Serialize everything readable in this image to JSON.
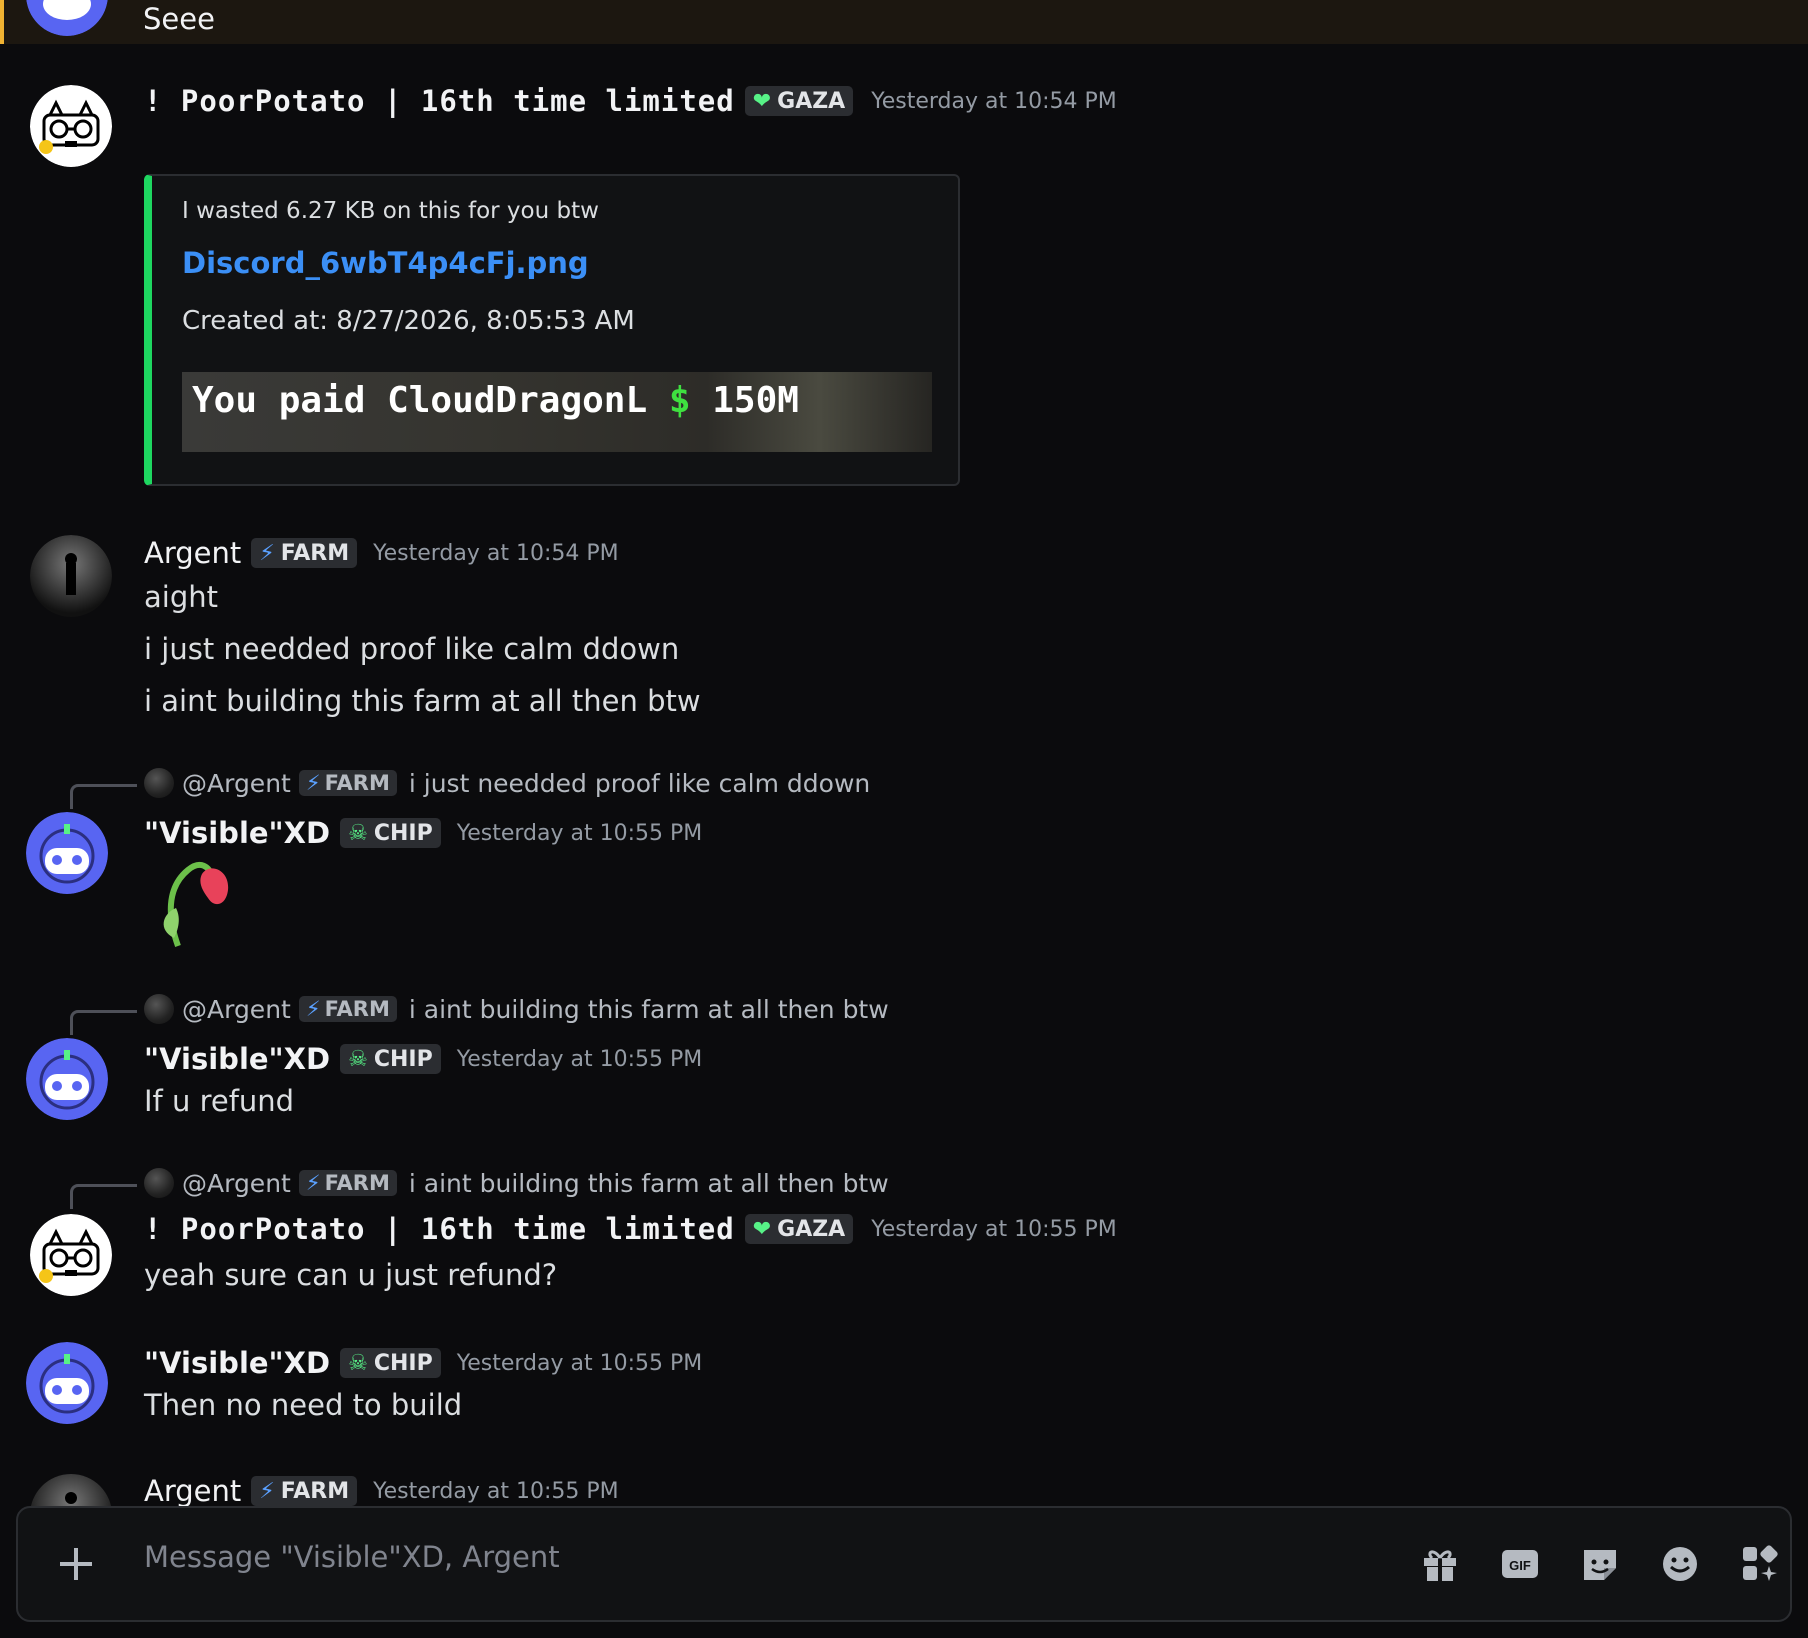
{
  "top_message": {
    "text": "Seee"
  },
  "messages": [
    {
      "author": "! PoorPotato | 16th time limited",
      "tag": "GAZA",
      "timestamp": "Yesterday at 10:54 PM",
      "embed": {
        "line1": "I wasted 6.27 KB on this for you btw",
        "link": "Discord_6wbT4p4cFj.png",
        "created": "Created at: 8/27/2026, 8:05:53 AM",
        "image_caption_prefix": "You paid CloudDragonL",
        "image_caption_symbol": "$",
        "image_caption_amount": "150M"
      }
    },
    {
      "author": "Argent",
      "tag": "FARM",
      "timestamp": "Yesterday at 10:54 PM",
      "lines": [
        "aight",
        "i just needded  proof like  calm ddown",
        "i aint building this farm at all then btw"
      ]
    },
    {
      "reply_to": {
        "name": "@Argent",
        "tag": "FARM",
        "text": "i just needded  proof like  calm ddown"
      },
      "author": "\"Visible\"XD",
      "tag": "CHIP",
      "timestamp": "Yesterday at 10:55 PM",
      "emoji": "wilted-flower"
    },
    {
      "reply_to": {
        "name": "@Argent",
        "tag": "FARM",
        "text": "i aint building this farm at all then btw"
      },
      "author": "\"Visible\"XD",
      "tag": "CHIP",
      "timestamp": "Yesterday at 10:55 PM",
      "lines": [
        "If u refund"
      ]
    },
    {
      "reply_to": {
        "name": "@Argent",
        "tag": "FARM",
        "text": "i aint building this farm at all then btw"
      },
      "author": "! PoorPotato | 16th time limited",
      "tag": "GAZA",
      "timestamp": "Yesterday at 10:55 PM",
      "lines": [
        "yeah sure can u just refund?"
      ]
    },
    {
      "author": "\"Visible\"XD",
      "tag": "CHIP",
      "timestamp": "Yesterday at 10:55 PM",
      "lines": [
        "Then no need to build"
      ]
    },
    {
      "author": "Argent",
      "tag": "FARM",
      "timestamp": "Yesterday at 10:55 PM"
    }
  ],
  "composer": {
    "placeholder": "Message \"Visible\"XD, Argent",
    "gif_label": "GIF",
    "icons": [
      "plus-icon",
      "gift-icon",
      "gif-icon",
      "sticker-icon",
      "emoji-icon",
      "apps-icon"
    ]
  },
  "colors": {
    "background": "#0b0b0d",
    "link": "#3b8ff6",
    "embed_accent": "#1ed760",
    "mention_highlight": "#f0b232",
    "discord_blurple": "#5865f2"
  }
}
